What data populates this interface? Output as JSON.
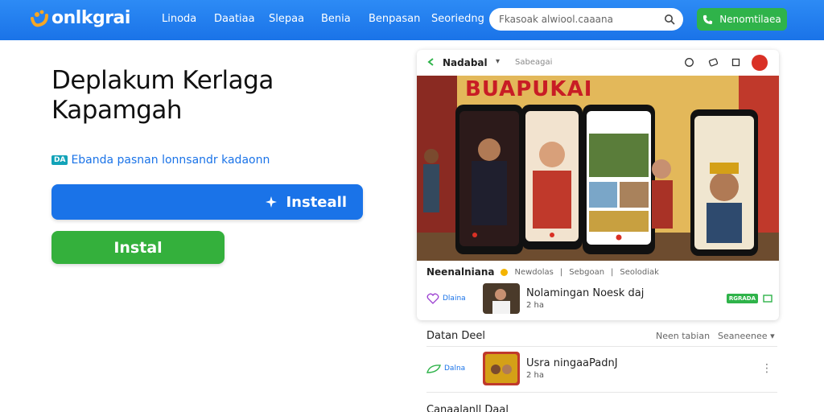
{
  "brand": {
    "name": "onlkgrai"
  },
  "nav": {
    "links": [
      "Linoda",
      "Daatiaa",
      "Slepaa",
      "Benia",
      "Benpasan",
      "Seoriedng"
    ],
    "search_placeholder": "Fkasoak alwiool.caaana",
    "cta_label": "Nenomtilaea"
  },
  "hero": {
    "title_line1": "Deplakum Kerlaga",
    "title_line2": "Kapamgah",
    "sub_badge": "DA",
    "subtitle": "Ebanda pasnan lonnsandr kadaonn",
    "primary_button": "Insteall",
    "secondary_button": "Instal"
  },
  "card": {
    "header_title": "Nadabal",
    "header_meta": "Sabeagai",
    "banner_title": "BUAPUKAI",
    "foot_name": "Neenalniana",
    "foot_meta1": "Newdolas",
    "foot_meta2": "Sebgoan",
    "foot_meta3": "Seolodiak",
    "row1_pill": "Dlaina",
    "row1_title": "Nolamingan Noesk daj",
    "row1_sub": "2 ha",
    "row1_tag": "RGRADA"
  },
  "section": {
    "title": "Datan Deel",
    "right1": "Neen tabian",
    "right2": "Seaneenee",
    "row_pill": "Dalna",
    "row_title": "Usra ningaaPadnJ",
    "row_sub": "2 ha",
    "next_title": "Canaalanll Daal"
  },
  "colors": {
    "topbar": "#1a73e8",
    "primary": "#1a73e8",
    "secondary": "#34b03c",
    "accent_red": "#d93025"
  }
}
